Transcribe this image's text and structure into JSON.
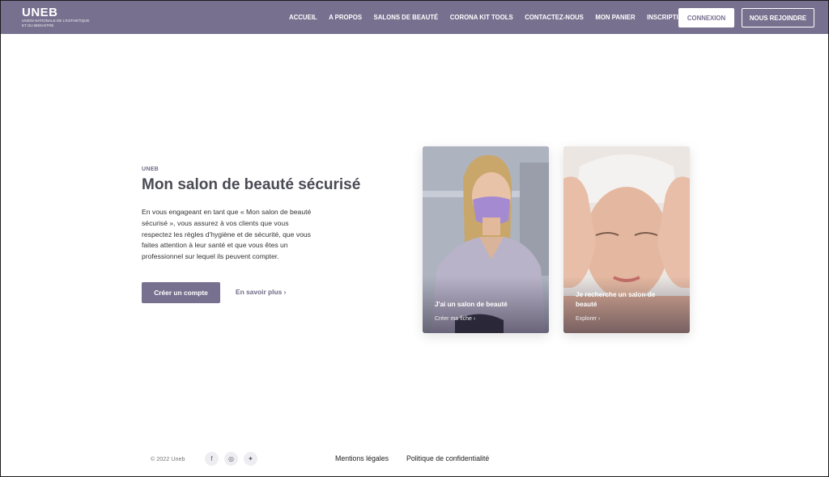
{
  "header": {
    "logo_title": "UNEB",
    "logo_subtitle": "Union Nationale de l'Esthetique et du Bien-Etre",
    "menu": [
      "ACCUEIL",
      "A PROPOS",
      "SALONS DE BEAUTÉ",
      "CORONA KIT TOOLS",
      "CONTACTEZ-NOUS",
      "MON PANIER",
      "INSCRIPTION"
    ],
    "login_label": "CONNEXION",
    "join_label": "NOUS REJOINDRE"
  },
  "hero": {
    "eyebrow": "UNEB",
    "title": "Mon salon de beauté sécurisé",
    "description": "En vous engageant en tant que « Mon salon de beauté sécurisé », vous assurez à vos clients que vous respectez les règles d'hygiène et de sécurité, que vous faites attention à leur santé et que vous êtes un professionnel sur lequel ils peuvent compter.",
    "cta_label": "Créer un compte",
    "more_label": "En savoir plus ›"
  },
  "cards": [
    {
      "title": "J'ai un salon de beauté",
      "link": "Créer ma fiche ›"
    },
    {
      "title": "Je recherche un salon de beauté",
      "link": "Explorer ›"
    }
  ],
  "footer": {
    "copyright": "© 2022 Uneb",
    "social": [
      "facebook-icon",
      "instagram-icon",
      "twitter-icon"
    ],
    "links": [
      "Mentions légales",
      "Politique de confidentialité"
    ]
  },
  "colors": {
    "brand": "#78708f"
  }
}
